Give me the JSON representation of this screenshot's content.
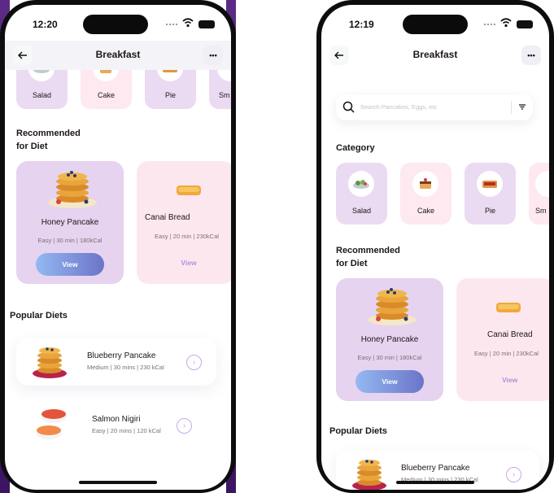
{
  "colors": {
    "accent_purple": "#eadbf2",
    "accent_pink": "#fde9ef",
    "view_gradient_start": "#93b9f1",
    "view_gradient_end": "#6c74c9",
    "view_link": "#b48de4"
  },
  "left": {
    "status_time": "12:20",
    "nav": {
      "back_icon": "arrow-left-icon",
      "title": "Breakfast",
      "more_icon": "more-dots-icon",
      "more_label": "•••"
    },
    "categories": [
      {
        "label": "Salad",
        "icon": "salad-icon"
      },
      {
        "label": "Cake",
        "icon": "cake-icon"
      },
      {
        "label": "Pie",
        "icon": "pie-icon"
      },
      {
        "label": "Sm",
        "icon": "smoothie-icon"
      }
    ],
    "recommended_title_line1": "Recommended",
    "recommended_title_line2": "for Diet",
    "diets": [
      {
        "name": "Honey Pancake",
        "meta": "Easy | 30 min | 180kCal",
        "button": "View"
      },
      {
        "name": "Canai Bread",
        "meta": "Easy | 20 min | 230kCal",
        "button": "View"
      }
    ],
    "popular_title": "Popular Diets",
    "popular": [
      {
        "name": "Blueberry Pancake",
        "meta": "Medium | 30 mins | 230 kCal"
      },
      {
        "name": "Salmon Nigiri",
        "meta": "Easy | 20 mins | 120 kCal"
      }
    ]
  },
  "right": {
    "status_time": "12:19",
    "nav": {
      "title": "Breakfast",
      "more_label": "•••"
    },
    "search": {
      "placeholder": "Search Pancakes, Eggs, etc",
      "icon": "search-icon",
      "filter_icon": "filter-icon"
    },
    "category_title": "Category",
    "categories": [
      {
        "label": "Salad"
      },
      {
        "label": "Cake"
      },
      {
        "label": "Pie"
      },
      {
        "label": "Sm"
      }
    ],
    "recommended_title_line1": "Recommended",
    "recommended_title_line2": "for Diet",
    "diets": [
      {
        "name": "Honey Pancake",
        "meta": "Easy | 30 min | 180kCal",
        "button": "View"
      },
      {
        "name": "Canai Bread",
        "meta": "Easy | 20 min | 230kCal",
        "button": "View"
      }
    ],
    "popular_title": "Popular Diets",
    "popular": [
      {
        "name": "Blueberry Pancake",
        "meta": "Medium | 30 mins | 230 kCal"
      }
    ]
  }
}
